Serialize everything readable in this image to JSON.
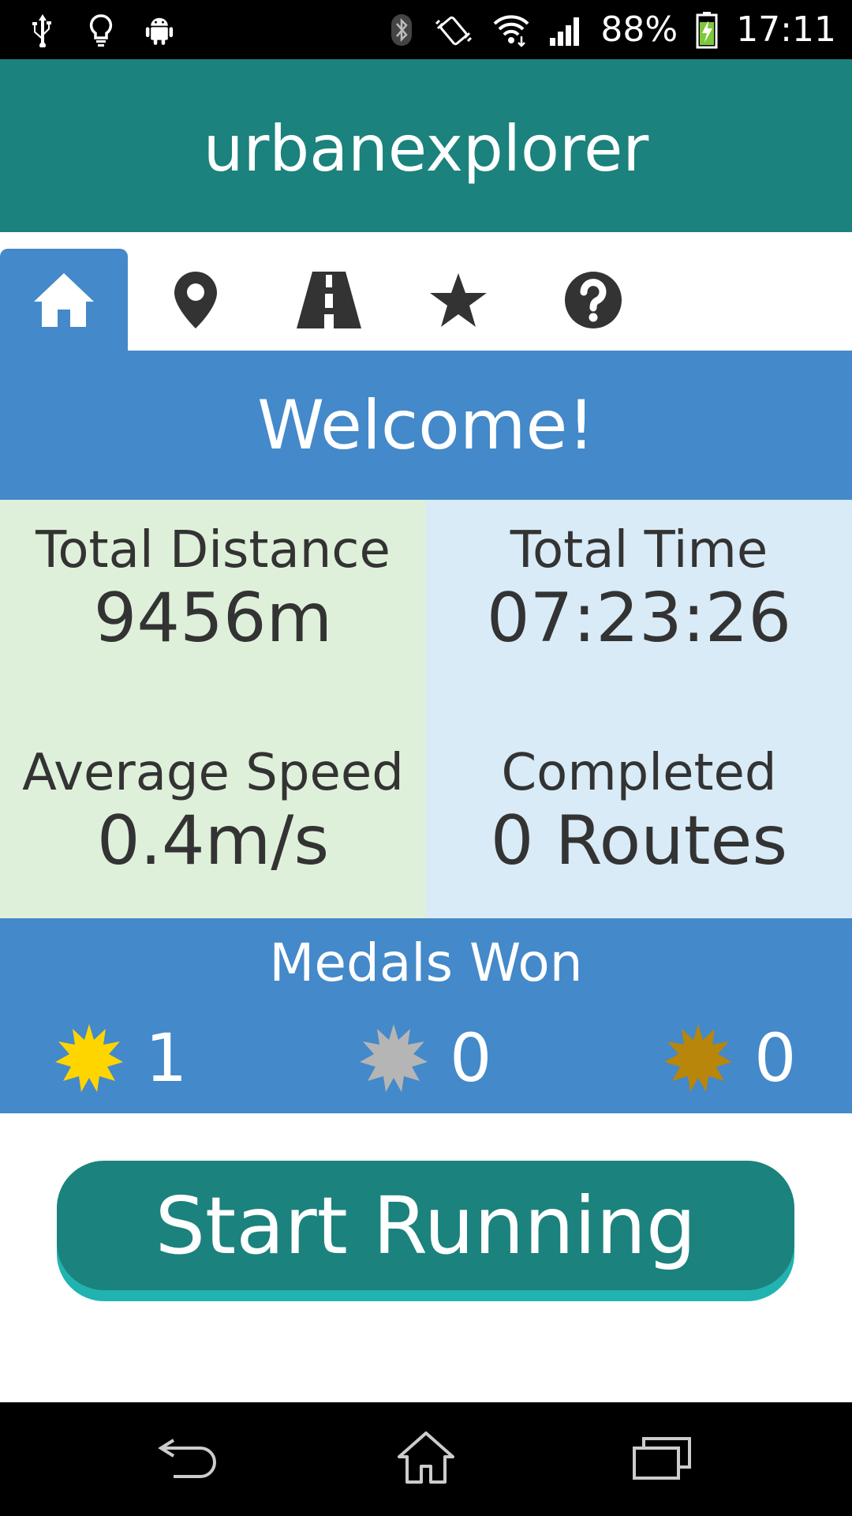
{
  "status_bar": {
    "battery_percent": "88%",
    "time": "17:11",
    "icons": [
      "usb-icon",
      "bulb-icon",
      "android-icon",
      "bluetooth-icon",
      "vibrate-icon",
      "wifi-icon",
      "signal-icon",
      "battery-charging-icon"
    ]
  },
  "header": {
    "title": "urbanexplorer"
  },
  "tabs": [
    {
      "name": "home",
      "icon": "home-icon",
      "active": true
    },
    {
      "name": "map",
      "icon": "map-pin-icon",
      "active": false
    },
    {
      "name": "routes",
      "icon": "road-icon",
      "active": false
    },
    {
      "name": "favorites",
      "icon": "star-icon",
      "active": false
    },
    {
      "name": "help",
      "icon": "help-icon",
      "active": false
    }
  ],
  "welcome": {
    "text": "Welcome!"
  },
  "stats": {
    "total_distance": {
      "label": "Total Distance",
      "value": "9456m"
    },
    "total_time": {
      "label": "Total Time",
      "value": "07:23:26"
    },
    "average_speed": {
      "label": "Average Speed",
      "value": "0.4m/s"
    },
    "completed": {
      "label": "Completed",
      "value": "0 Routes"
    }
  },
  "medals": {
    "title": "Medals Won",
    "gold": {
      "count": "1",
      "color": "#ffd500",
      "icon": "gold-medal-icon"
    },
    "silver": {
      "count": "0",
      "color": "#b5b5b5",
      "icon": "silver-medal-icon"
    },
    "bronze": {
      "count": "0",
      "color": "#b8860b",
      "icon": "bronze-medal-icon"
    }
  },
  "start_button": {
    "label": "Start Running"
  },
  "colors": {
    "header": "#1b827d",
    "accent_blue": "#4489c9",
    "stats_left": "#dff0da",
    "stats_right": "#d8ebf6",
    "button_shadow": "#21b3b0"
  },
  "nav_bar": {
    "icons": [
      "back-icon",
      "home-nav-icon",
      "recents-icon"
    ]
  }
}
